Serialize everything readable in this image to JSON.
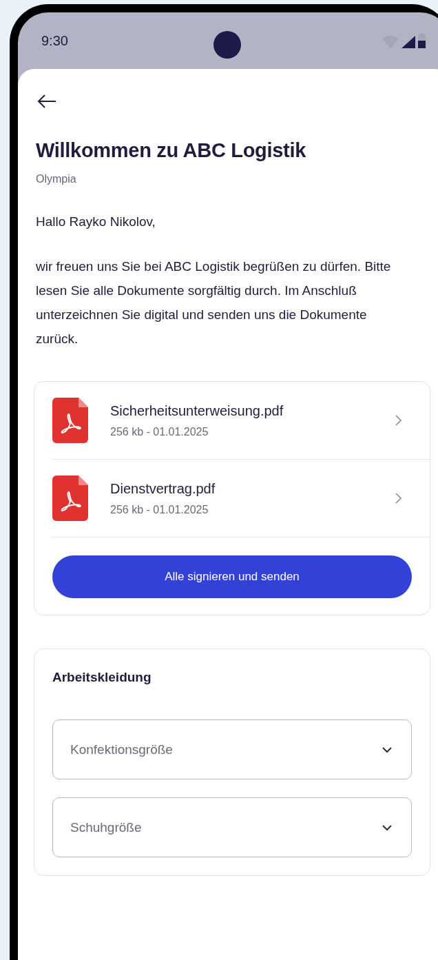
{
  "status_bar": {
    "time": "9:30"
  },
  "header": {
    "title": "Willkommen zu ABC Logistik",
    "subtitle": "Olympia"
  },
  "greeting": "Hallo Rayko Nikolov,",
  "message": "wir freuen uns Sie bei ABC Logistik begrüßen zu dürfen. Bitte lesen Sie alle Dokumente sorgfältig durch. Im Anschluß unterzeichnen Sie digital und senden uns die Dokumente zurück.",
  "documents": [
    {
      "name": "Sicherheitsunterweisung.pdf",
      "meta": "256 kb - 01.01.2025"
    },
    {
      "name": "Dienstvertrag.pdf",
      "meta": "256 kb - 01.01.2025"
    }
  ],
  "sign_button": "Alle signieren und senden",
  "workwear": {
    "title": "Arbeitskleidung",
    "selects": [
      {
        "placeholder": "Konfektionsgröße"
      },
      {
        "placeholder": "Schuhgröße"
      }
    ]
  }
}
